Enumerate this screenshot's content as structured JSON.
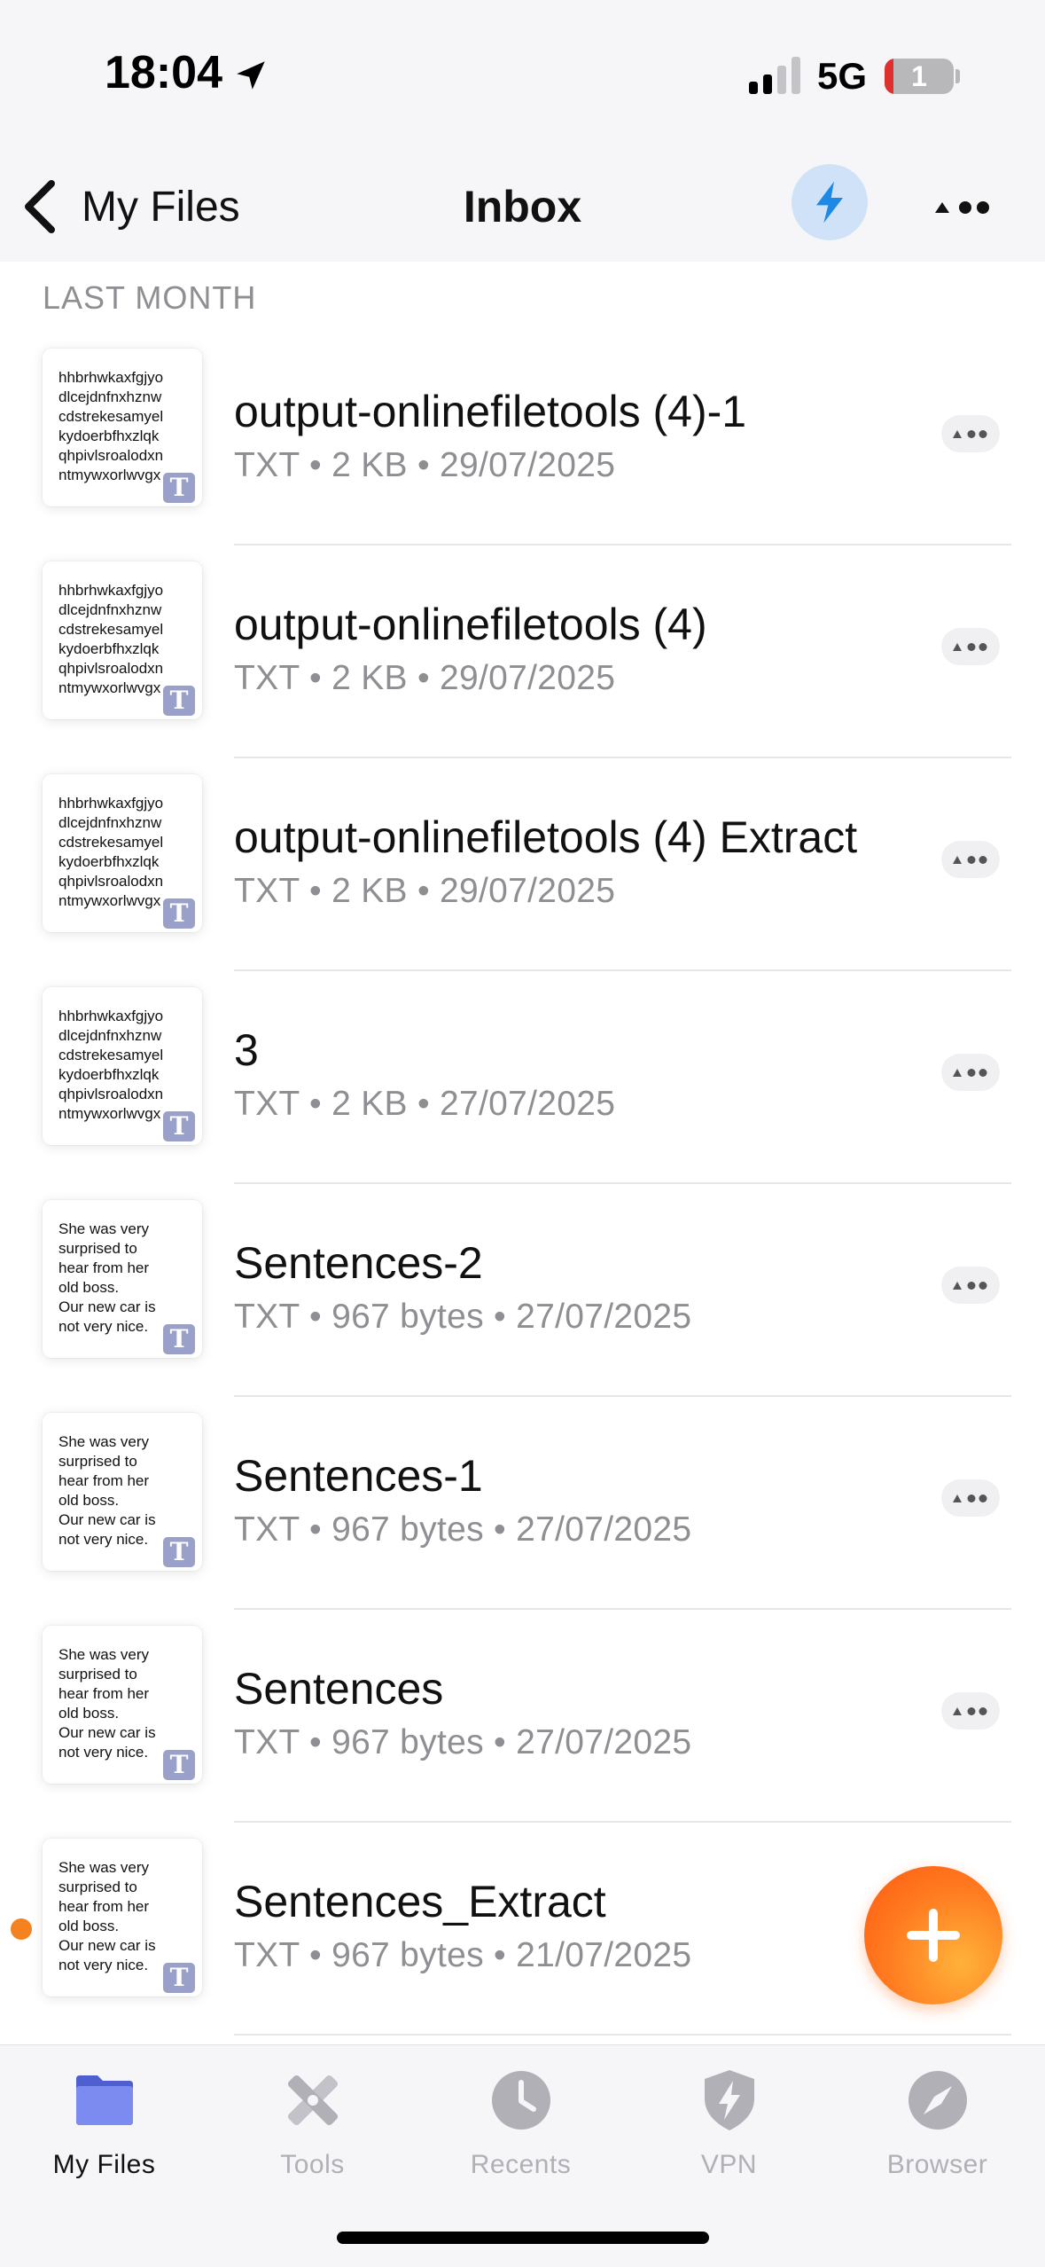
{
  "status_bar": {
    "time": "18:04",
    "network": "5G",
    "battery": "1"
  },
  "nav": {
    "back_label": "My Files",
    "title": "Inbox"
  },
  "section": {
    "header": "LAST MONTH"
  },
  "files": [
    {
      "name": "output-onlinefiletools (4)-1",
      "meta": "TXT • 2 KB • 29/07/2025",
      "thumb": "hhbrhwkaxfgjyo\ndlcejdnfnxhznw\ncdstrekesamyel\nkydoerbfhxzlqk\nqhpivlsroalodxn\nntmywxorlwvgx",
      "badge": "T",
      "unread": false
    },
    {
      "name": "output-onlinefiletools (4)",
      "meta": "TXT • 2 KB • 29/07/2025",
      "thumb": "hhbrhwkaxfgjyo\ndlcejdnfnxhznw\ncdstrekesamyel\nkydoerbfhxzlqk\nqhpivlsroalodxn\nntmywxorlwvgx",
      "badge": "T",
      "unread": false
    },
    {
      "name": "output-onlinefiletools (4) Extract",
      "meta": "TXT • 2 KB • 29/07/2025",
      "thumb": "hhbrhwkaxfgjyo\ndlcejdnfnxhznw\ncdstrekesamyel\nkydoerbfhxzlqk\nqhpivlsroalodxn\nntmywxorlwvgx",
      "badge": "T",
      "unread": false
    },
    {
      "name": "3",
      "meta": "TXT • 2 KB • 27/07/2025",
      "thumb": "hhbrhwkaxfgjyo\ndlcejdnfnxhznw\ncdstrekesamyel\nkydoerbfhxzlqk\nqhpivlsroalodxn\nntmywxorlwvgx",
      "badge": "T",
      "unread": false
    },
    {
      "name": "Sentences-2",
      "meta": "TXT • 967 bytes • 27/07/2025",
      "thumb": "She was very\nsurprised to\nhear from her\nold boss.\nOur new car is\nnot very nice.",
      "badge": "T",
      "unread": false
    },
    {
      "name": "Sentences-1",
      "meta": "TXT • 967 bytes • 27/07/2025",
      "thumb": "She was very\nsurprised to\nhear from her\nold boss.\nOur new car is\nnot very nice.",
      "badge": "T",
      "unread": false
    },
    {
      "name": "Sentences",
      "meta": "TXT • 967 bytes • 27/07/2025",
      "thumb": "She was very\nsurprised to\nhear from her\nold boss.\nOur new car is\nnot very nice.",
      "badge": "T",
      "unread": false
    },
    {
      "name": "Sentences_Extract",
      "meta": "TXT • 967 bytes • 21/07/2025",
      "thumb": "She was very\nsurprised to\nhear from her\nold boss.\nOur new car is\nnot very nice.",
      "badge": "T",
      "unread": true
    }
  ],
  "tabs": [
    {
      "label": "My Files",
      "icon": "folder-icon",
      "active": true
    },
    {
      "label": "Tools",
      "icon": "tools-icon",
      "active": false
    },
    {
      "label": "Recents",
      "icon": "clock-icon",
      "active": false
    },
    {
      "label": "VPN",
      "icon": "shield-bolt-icon",
      "active": false
    },
    {
      "label": "Browser",
      "icon": "compass-icon",
      "active": false
    }
  ],
  "colors": {
    "accent_orange": "#FF7A1F",
    "bolt_blue": "#1E88E5",
    "active_folder": "#6B7BE8",
    "unread_dot": "#F58220"
  }
}
